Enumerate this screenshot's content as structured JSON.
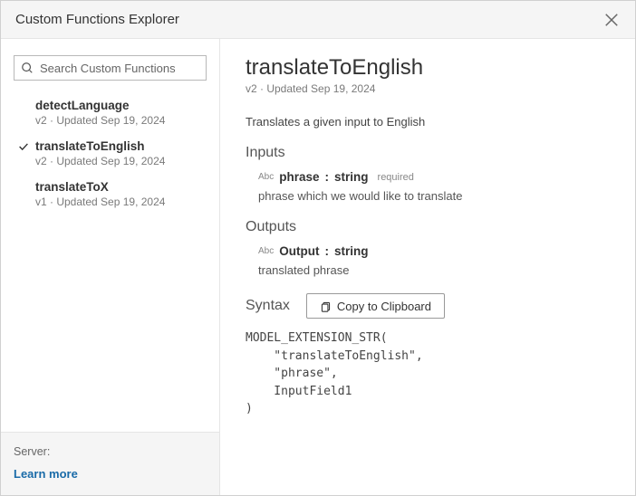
{
  "window": {
    "title": "Custom Functions Explorer"
  },
  "search": {
    "placeholder": "Search Custom Functions"
  },
  "functions": [
    {
      "name": "detectLanguage",
      "meta": "v2 · Updated Sep 19, 2024",
      "selected": false
    },
    {
      "name": "translateToEnglish",
      "meta": "v2 · Updated Sep 19, 2024",
      "selected": true
    },
    {
      "name": "translateToX",
      "meta": "v1 · Updated Sep 19, 2024",
      "selected": false
    }
  ],
  "footer": {
    "server_label": "Server:",
    "learn_more": "Learn more"
  },
  "detail": {
    "title": "translateToEnglish",
    "meta": "v2 · Updated Sep 19, 2024",
    "description": "Translates a given input to English",
    "inputs_heading": "Inputs",
    "input": {
      "type_tag": "Abc",
      "name": "phrase",
      "sep": ":",
      "type": "string",
      "required": "required",
      "desc": "phrase which we would like to translate"
    },
    "outputs_heading": "Outputs",
    "output": {
      "type_tag": "Abc",
      "name": "Output",
      "sep": ":",
      "type": "string",
      "desc": "translated phrase"
    },
    "syntax_heading": "Syntax",
    "copy_label": "Copy to Clipboard",
    "code": "MODEL_EXTENSION_STR(\n    \"translateToEnglish\",\n    \"phrase\",\n    InputField1\n)"
  }
}
